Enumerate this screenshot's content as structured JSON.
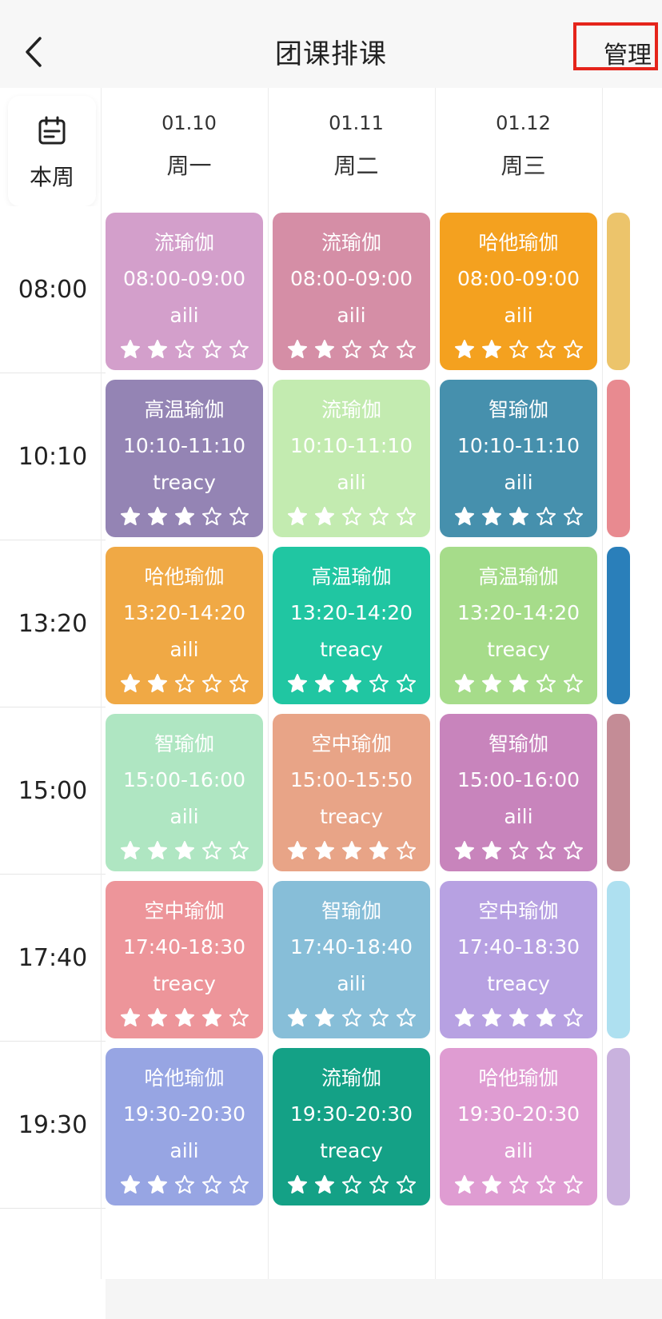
{
  "header": {
    "title": "团课排课",
    "manage_label": "管理"
  },
  "week_button": {
    "label": "本周",
    "icon": "calendar-icon"
  },
  "days": [
    {
      "date": "01.10",
      "weekday": "周一"
    },
    {
      "date": "01.11",
      "weekday": "周二"
    },
    {
      "date": "01.12",
      "weekday": "周三"
    }
  ],
  "times": [
    "08:00",
    "10:10",
    "13:20",
    "15:00",
    "17:40",
    "19:30"
  ],
  "courses": [
    [
      {
        "name": "流瑜伽",
        "time": "08:00-09:00",
        "teacher": "aili",
        "rating": 2,
        "color": "#d39fcb"
      },
      {
        "name": "高温瑜伽",
        "time": "10:10-11:10",
        "teacher": "treacy",
        "rating": 3,
        "color": "#9484b4"
      },
      {
        "name": "哈他瑜伽",
        "time": "13:20-14:20",
        "teacher": "aili",
        "rating": 2,
        "color": "#f0a945"
      },
      {
        "name": "智瑜伽",
        "time": "15:00-16:00",
        "teacher": "aili",
        "rating": 3,
        "color": "#afe6c2"
      },
      {
        "name": "空中瑜伽",
        "time": "17:40-18:30",
        "teacher": "treacy",
        "rating": 4,
        "color": "#ed959a"
      },
      {
        "name": "哈他瑜伽",
        "time": "19:30-20:30",
        "teacher": "aili",
        "rating": 2,
        "color": "#97a5e3"
      }
    ],
    [
      {
        "name": "流瑜伽",
        "time": "08:00-09:00",
        "teacher": "aili",
        "rating": 2,
        "color": "#d58ea6"
      },
      {
        "name": "流瑜伽",
        "time": "10:10-11:10",
        "teacher": "aili",
        "rating": 2,
        "color": "#c3ebb0"
      },
      {
        "name": "高温瑜伽",
        "time": "13:20-14:20",
        "teacher": "treacy",
        "rating": 3,
        "color": "#20c6a2"
      },
      {
        "name": "空中瑜伽",
        "time": "15:00-15:50",
        "teacher": "treacy",
        "rating": 4,
        "color": "#e8a487"
      },
      {
        "name": "智瑜伽",
        "time": "17:40-18:40",
        "teacher": "aili",
        "rating": 2,
        "color": "#87bed8"
      },
      {
        "name": "流瑜伽",
        "time": "19:30-20:30",
        "teacher": "treacy",
        "rating": 2,
        "color": "#14a186"
      }
    ],
    [
      {
        "name": "哈他瑜伽",
        "time": "08:00-09:00",
        "teacher": "aili",
        "rating": 2,
        "color": "#f4a11f"
      },
      {
        "name": "智瑜伽",
        "time": "10:10-11:10",
        "teacher": "aili",
        "rating": 3,
        "color": "#4690ad"
      },
      {
        "name": "高温瑜伽",
        "time": "13:20-14:20",
        "teacher": "treacy",
        "rating": 3,
        "color": "#a6dc8a"
      },
      {
        "name": "智瑜伽",
        "time": "15:00-16:00",
        "teacher": "aili",
        "rating": 2,
        "color": "#c884bc"
      },
      {
        "name": "空中瑜伽",
        "time": "17:40-18:30",
        "teacher": "treacy",
        "rating": 4,
        "color": "#b7a1e2"
      },
      {
        "name": "哈他瑜伽",
        "time": "19:30-20:30",
        "teacher": "aili",
        "rating": 2,
        "color": "#df9cd2"
      }
    ]
  ],
  "partial_column_colors": [
    "#ecc46b",
    "#e88a90",
    "#2a7fba",
    "#c48c96",
    "#aee0f0",
    "#c9b2de"
  ]
}
